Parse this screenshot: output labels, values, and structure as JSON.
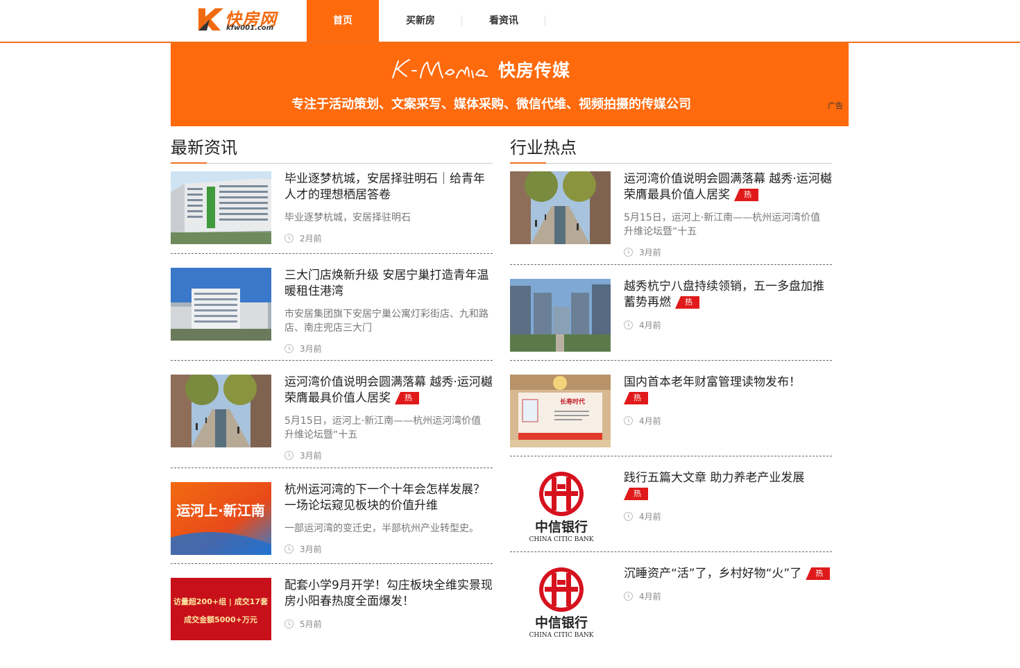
{
  "header": {
    "logo": {
      "text": "快房网",
      "sub": "kfw001.com"
    },
    "nav": [
      {
        "label": "首页",
        "active": true
      },
      {
        "label": "买新房",
        "active": false
      },
      {
        "label": "看资讯",
        "active": false
      }
    ]
  },
  "banner": {
    "script_text": "K-Media",
    "title": "快房传媒",
    "slogan": "专注于活动策划、文案采写、媒体采购、微信代维、视频拍摄的传媒公司",
    "ad_label": "广告",
    "color": "#ff6a0d"
  },
  "latest": {
    "heading": "最新资讯",
    "items": [
      {
        "title": "毕业逐梦杭城，安居择驻明石｜给青年人才的理想栖居答卷",
        "hot": false,
        "desc": "毕业逐梦杭城，安居择驻明石",
        "time": "2月前",
        "thumb": "apartment-building-photo"
      },
      {
        "title": "三大门店焕新升级 安居宁巢打造青年温暖租住港湾",
        "hot": false,
        "desc": "市安居集团旗下安居宁巢公寓灯彩街店、九和路店、南庄兜店三大门",
        "time": "3月前",
        "thumb": "office-building-photo"
      },
      {
        "title": "运河湾价值说明会圆满落幕 越秀·运河樾荣膺最具价值人居奖",
        "hot": true,
        "desc": "5月15日，运河上·新江南——杭州运河湾价值升维论坛暨“十五",
        "time": "3月前",
        "thumb": "plaza-rendering"
      },
      {
        "title": "杭州运河湾的下一个十年会怎样发展？一场论坛窥见板块的价值升维",
        "hot": false,
        "desc": "一部运河湾的变迁史，半部杭州产业转型史。",
        "time": "3月前",
        "thumb": "forum-poster",
        "thumb_text": "运河上·新江南"
      },
      {
        "title": "配套小学9月开学！勾庄板块全维实景现房小阳春热度全面爆发！",
        "hot": false,
        "desc": "",
        "time": "5月前",
        "thumb": "sales-poster",
        "thumb_lines": [
          "访量超200+组 | 成交17套",
          "成交金额5000+万元"
        ]
      }
    ]
  },
  "hot": {
    "heading": "行业热点",
    "hot_label": "热",
    "items": [
      {
        "title": "运河湾价值说明会圆满落幕 越秀·运河樾荣膺最具价值人居奖",
        "hot": true,
        "desc": "5月15日，运河上·新江南——杭州运河湾价值升维论坛暨“十五",
        "time": "3月前",
        "thumb": "plaza-rendering"
      },
      {
        "title": "越秀杭宁八盘持续领销，五一多盘加推蓄势再燃",
        "hot": true,
        "desc": "",
        "time": "4月前",
        "thumb": "residential-complex-photo"
      },
      {
        "title": "国内首本老年财富管理读物发布！",
        "hot": true,
        "desc": "",
        "time": "4月前",
        "thumb": "conference-photo",
        "thumb_text": "长寿时代"
      },
      {
        "title": "践行五篇大文章 助力养老产业发展",
        "hot": true,
        "desc": "",
        "time": "4月前",
        "thumb": "citic-bank-logo",
        "thumb_lines": [
          "中信银行",
          "CHINA CITIC BANK"
        ]
      },
      {
        "title": "沉睡资产“活”了，乡村好物“火”了",
        "hot": true,
        "desc": "",
        "time": "4月前",
        "thumb": "citic-bank-logo",
        "thumb_lines": [
          "中信银行",
          "CHINA CITIC BANK"
        ]
      }
    ]
  }
}
